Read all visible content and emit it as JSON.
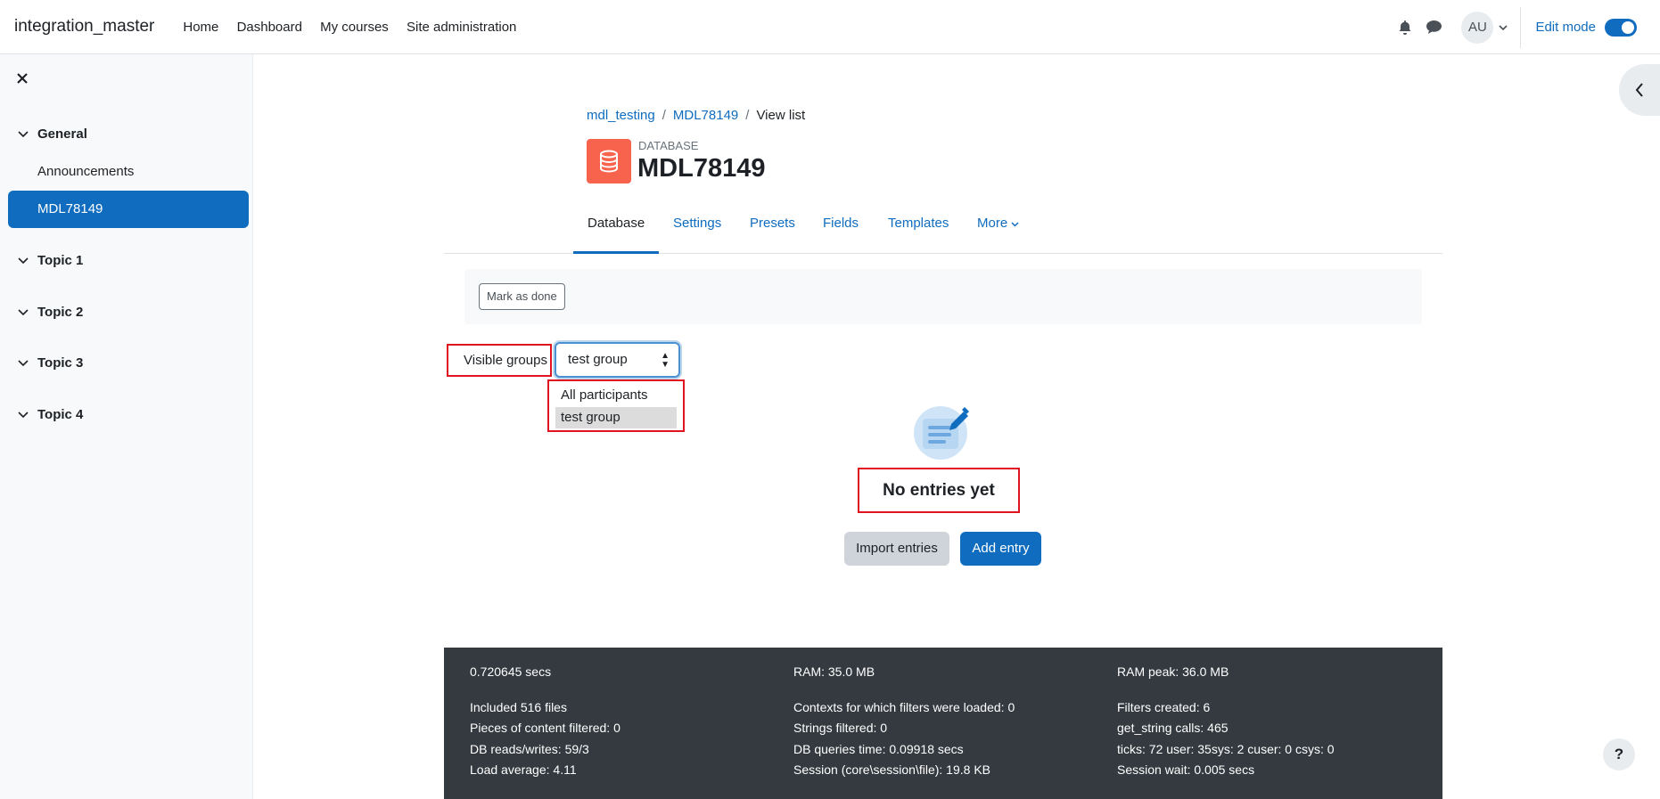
{
  "navbar": {
    "brand": "integration_master",
    "links": [
      "Home",
      "Dashboard",
      "My courses",
      "Site administration"
    ],
    "avatar_initials": "AU",
    "edit_mode_label": "Edit mode"
  },
  "drawer": {
    "sections": [
      {
        "label": "General",
        "items": [
          "Announcements",
          "MDL78149"
        ]
      },
      {
        "label": "Topic 1"
      },
      {
        "label": "Topic 2"
      },
      {
        "label": "Topic 3"
      },
      {
        "label": "Topic 4"
      }
    ],
    "active_item": "MDL78149"
  },
  "breadcrumb": [
    "mdl_testing",
    "MDL78149",
    "View list"
  ],
  "module": {
    "type": "DATABASE",
    "title": "MDL78149",
    "icon_color": "#f7634d"
  },
  "tabs": [
    "Database",
    "Settings",
    "Presets",
    "Fields",
    "Templates",
    "More"
  ],
  "active_tab": "Database",
  "mark_done_label": "Mark as done",
  "groups": {
    "label": "Visible groups",
    "selected": "test group",
    "options": [
      "All participants",
      "test group"
    ]
  },
  "empty_state": {
    "message": "No entries yet",
    "import_label": "Import entries",
    "add_label": "Add entry"
  },
  "footer": {
    "col1": [
      "0.720645 secs",
      "Included 516 files",
      "Pieces of content filtered: 0",
      "DB reads/writes: 59/3",
      "Load average: 4.11"
    ],
    "col2": [
      "RAM: 35.0 MB",
      "Contexts for which filters were loaded: 0",
      "Strings filtered: 0",
      "DB queries time: 0.09918 secs",
      "Session (core\\session\\file): 19.8 KB"
    ],
    "col3": [
      "RAM peak: 36.0 MB",
      "Filters created: 6",
      "get_string calls: 465",
      "ticks: 72 user: 35sys: 2 cuser: 0 csys: 0",
      "Session wait: 0.005 secs"
    ]
  },
  "help_label": "?",
  "colors": {
    "primary": "#0f6cbf",
    "highlight_border": "#e0141e",
    "footer_bg": "#343a40"
  }
}
